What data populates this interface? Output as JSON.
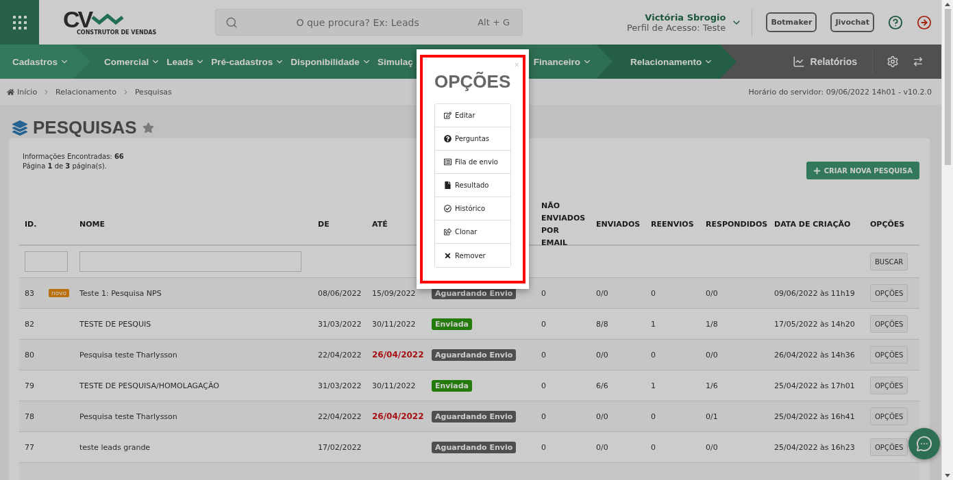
{
  "header": {
    "logo_mark": "CV",
    "logo_caption": "CONSTRUTOR DE VENDAS",
    "search": {
      "placeholder": "O que procura? Ex: Leads",
      "shortcut": "Alt + G"
    },
    "user": {
      "name": "Victória Sbrogio",
      "profile": "Perfil de Acesso: Teste"
    },
    "buttons": [
      "Botmaker",
      "Jivochat"
    ]
  },
  "nav": {
    "items": [
      {
        "label": "Cadastros",
        "selected": false,
        "dropdown": true
      },
      {
        "label": "Comercial",
        "selected": false,
        "dropdown": true
      },
      {
        "label": "Leads",
        "selected": false,
        "dropdown": true
      },
      {
        "label": "Pré-cadastros",
        "selected": false,
        "dropdown": true
      },
      {
        "label": "Disponibilidade",
        "selected": false,
        "dropdown": true
      },
      {
        "label": "Simulaç",
        "selected": false,
        "dropdown": false
      },
      {
        "label": "Financeiro",
        "selected": false,
        "dropdown": true
      },
      {
        "label": "Relacionamento",
        "selected": true,
        "dropdown": true
      }
    ],
    "reports": "Relatórios"
  },
  "breadcrumb": {
    "items": [
      "Início",
      "Relacionamento",
      "Pesquisas"
    ],
    "server_time": "Horário do servidor: 09/06/2022 14h01 - v10.2.0"
  },
  "page": {
    "title": "PESQUISAS",
    "favorite": false
  },
  "card": {
    "info": [
      "Informações Encontradas: **66**",
      "Página **1** de **3** página(s)."
    ],
    "create_button": "CRIAR NOVA PESQUISA",
    "table": {
      "columns": [
        "ID.",
        "NOME",
        "DE",
        "ATÉ",
        "NÃO ENVIADOS POR EMAIL",
        "ENVIADOS",
        "REENVIOS",
        "RESPONDIDOS",
        "DATA DE CRIAÇÃO",
        "OPÇÕES"
      ],
      "search_button": "BUSCAR",
      "rows": [
        {
          "id": "83",
          "badge": "novo",
          "name": "Teste 1: Pesquisa NPS",
          "from": "08/06/2022",
          "to": "15/09/2022",
          "overdue": false,
          "status": {
            "label": "Aguardando Envio",
            "kind": "waiting"
          },
          "not_sent": "0",
          "sent": "0/0",
          "resent": "0",
          "answered": "0/0",
          "created": "09/06/2022 às 11h19",
          "action": "OPÇÕES"
        },
        {
          "id": "82",
          "name": "TESTE DE PESQUIS",
          "from": "31/03/2022",
          "to": "30/11/2022",
          "overdue": false,
          "status": {
            "label": "Enviada",
            "kind": "sent"
          },
          "not_sent": "0",
          "sent": "8/8",
          "resent": "1",
          "answered": "1/8",
          "created": "17/05/2022 às 14h20",
          "action": "OPÇÕES"
        },
        {
          "id": "80",
          "name": "Pesquisa teste Tharlysson",
          "from": "22/04/2022",
          "to": "26/04/2022",
          "overdue": true,
          "status": {
            "label": "Aguardando Envio",
            "kind": "waiting"
          },
          "not_sent": "0",
          "sent": "0/0",
          "resent": "0",
          "answered": "0/0",
          "created": "26/04/2022 às 14h36",
          "action": "OPÇÕES"
        },
        {
          "id": "79",
          "name": "TESTE DE PESQUISA/HOMOLAGAÇÃO",
          "from": "31/03/2022",
          "to": "30/11/2022",
          "overdue": false,
          "status": {
            "label": "Enviada",
            "kind": "sent"
          },
          "not_sent": "0",
          "sent": "6/6",
          "resent": "1",
          "answered": "1/6",
          "created": "25/04/2022 às 17h01",
          "action": "OPÇÕES"
        },
        {
          "id": "78",
          "name": "Pesquisa teste Tharlysson",
          "from": "22/04/2022",
          "to": "26/04/2022",
          "overdue": true,
          "status": {
            "label": "Aguardando Envio",
            "kind": "waiting"
          },
          "not_sent": "0",
          "sent": "0/0",
          "resent": "0",
          "answered": "0/1",
          "created": "25/04/2022 às 16h41",
          "action": "OPÇÕES"
        },
        {
          "id": "77",
          "name": "teste leads grande",
          "from": "17/02/2022",
          "status": {
            "label": "Aguardando Envio",
            "kind": "waiting"
          },
          "not_sent": "0",
          "sent": "0/0",
          "resent": "0",
          "answered": "0/0",
          "created": "25/04/2022 às 16h23",
          "action": "OPÇÕES"
        }
      ]
    }
  },
  "modal": {
    "title": "OPÇÕES",
    "close": "×",
    "highlighted": true,
    "options": [
      {
        "label": "Editar",
        "kind": "edit"
      },
      {
        "label": "Perguntas",
        "kind": "questions"
      },
      {
        "label": "Fila de envio",
        "kind": "queue"
      },
      {
        "label": "Resultado",
        "kind": "result"
      },
      {
        "label": "Histórico",
        "kind": "history"
      },
      {
        "label": "Clonar",
        "kind": "clone"
      },
      {
        "label": "Remover",
        "kind": "remove"
      }
    ]
  }
}
